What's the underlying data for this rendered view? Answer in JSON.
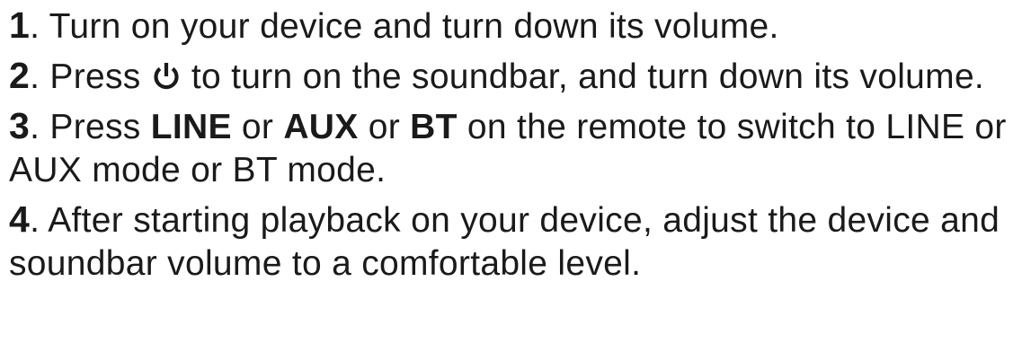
{
  "steps": [
    {
      "number": "1",
      "text": ". Turn on your device and turn down its volume."
    },
    {
      "number": "2",
      "text_before": ". Press ",
      "icon": "power-icon",
      "text_after": " to turn on the soundbar, and turn down its volume."
    },
    {
      "number": "3",
      "text_1": ". Press ",
      "kw_1": "LINE",
      "text_2": " or ",
      "kw_2": "AUX",
      "text_3": " or ",
      "kw_3": "BT",
      "text_4": " on the remote to switch to LINE or AUX mode or BT mode."
    },
    {
      "number": "4",
      "text": ". After starting playback on your device, adjust the device and soundbar volume to a comfortable level."
    }
  ]
}
